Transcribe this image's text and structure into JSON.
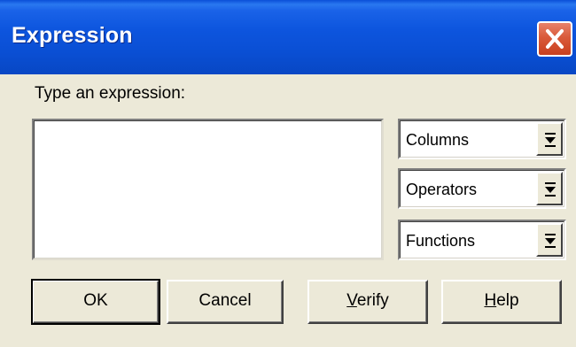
{
  "window": {
    "title": "Expression",
    "close_icon": "close-x-icon",
    "accent": "#0a4fd4",
    "close_color": "#d95a3a",
    "background": "#ece9d8"
  },
  "prompt": {
    "label": "Type an expression:"
  },
  "expression": {
    "value": "",
    "placeholder": ""
  },
  "dropdowns": {
    "columns": "Columns",
    "operators": "Operators",
    "functions": "Functions",
    "arrow_icon": "drop-arrow-icon"
  },
  "buttons": {
    "ok": "OK",
    "cancel": "Cancel",
    "verify_first": "V",
    "verify_rest": "erify",
    "help_first": "H",
    "help_rest": "elp"
  }
}
